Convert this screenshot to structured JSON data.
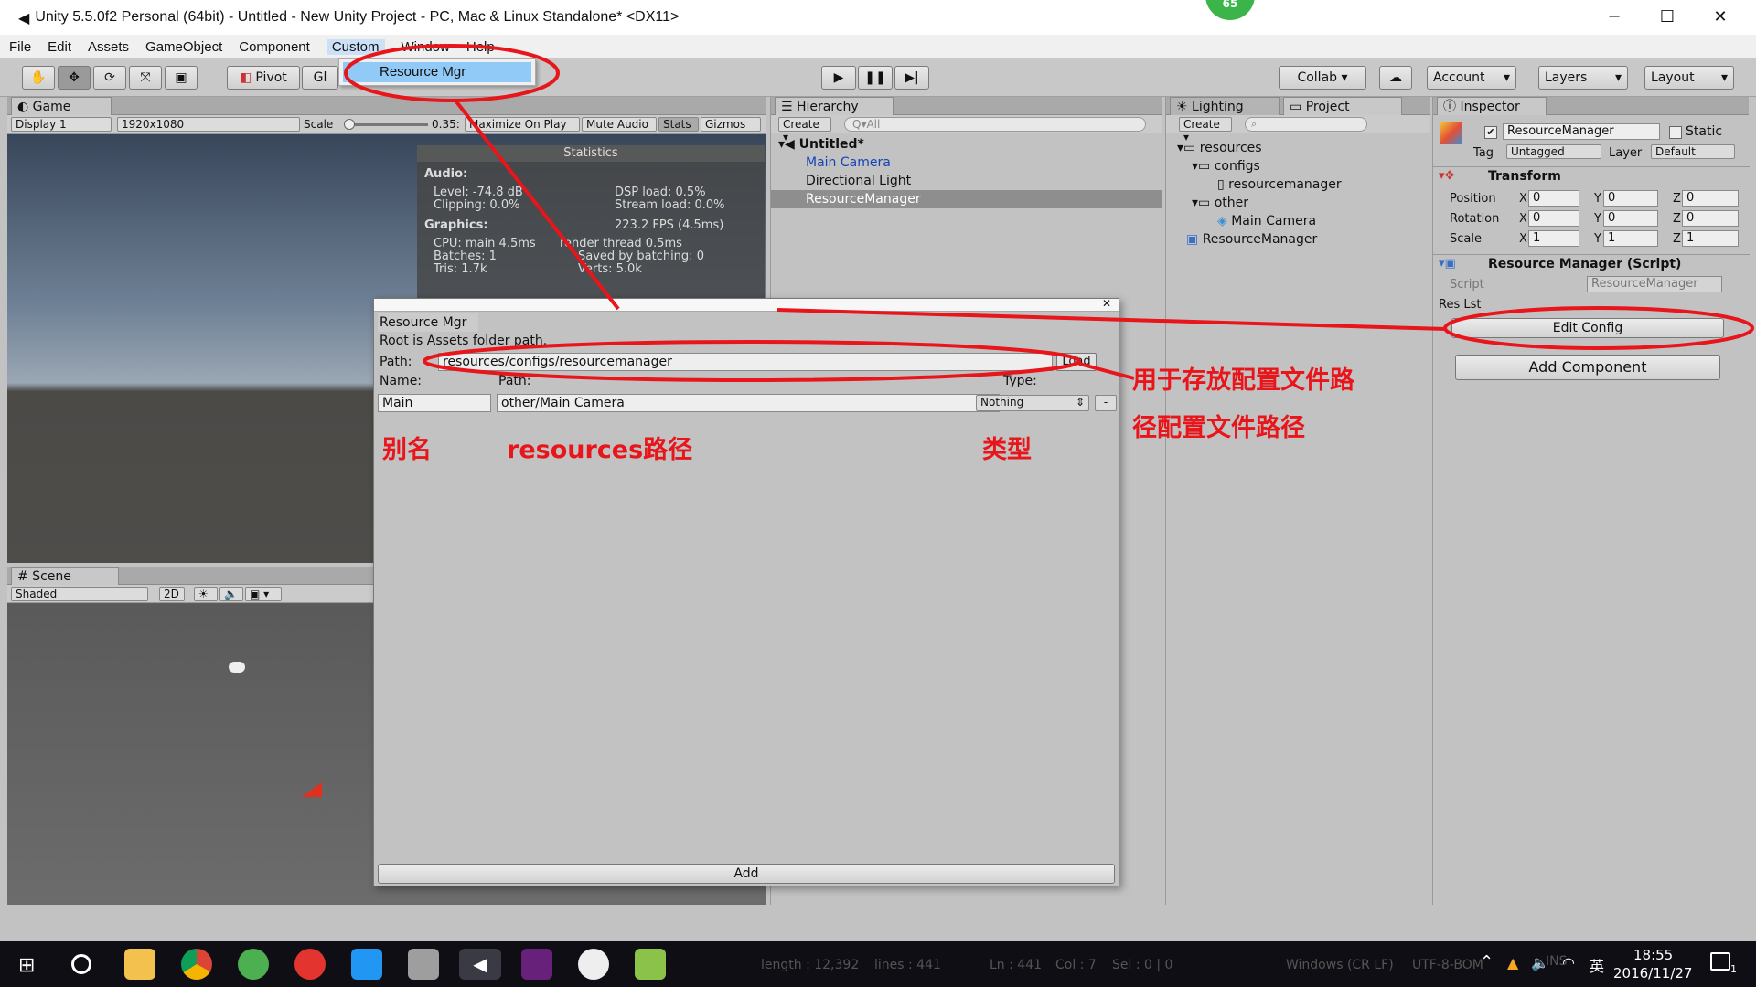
{
  "window": {
    "title": "Unity 5.5.0f2 Personal (64bit) - Untitled - New Unity Project - PC, Mac & Linux Standalone* <DX11>",
    "minimize": "─",
    "maximize": "☐",
    "close": "✕",
    "badge": "65"
  },
  "menu": [
    "File",
    "Edit",
    "Assets",
    "GameObject",
    "Component",
    "Custom",
    "Window",
    "Help"
  ],
  "menu_dropdown": {
    "item": "Resource Mgr"
  },
  "toolbar": {
    "pivot": "Pivot",
    "global": "Gl",
    "collab": "Collab ▾",
    "account": "Account",
    "layers": "Layers",
    "layout": "Layout"
  },
  "game": {
    "tab": "Game",
    "display": "Display 1",
    "resolution": "1920x1080",
    "scale_label": "Scale",
    "scale_value": "0.35:",
    "maximize": "Maximize On Play",
    "mute": "Mute Audio",
    "stats": "Stats",
    "gizmos": "Gizmos"
  },
  "statistics": {
    "title": "Statistics",
    "audio": "Audio:",
    "level": "Level: -74.8 dB",
    "clipping": "Clipping: 0.0%",
    "dsp": "DSP load: 0.5%",
    "stream": "Stream load: 0.0%",
    "graphics": "Graphics:",
    "fps": "223.2 FPS (4.5ms)",
    "cpu": "CPU: main 4.5ms",
    "render": "render thread 0.5ms",
    "batches": "Batches: 1",
    "saved": "Saved by batching: 0",
    "tris": "Tris: 1.7k",
    "verts": "Verts: 5.0k"
  },
  "scene": {
    "tab": "Scene",
    "shaded": "Shaded",
    "twod": "2D"
  },
  "hierarchy": {
    "tab": "Hierarchy",
    "create": "Create ▾",
    "search": "Q▾All",
    "scene": "Untitled*",
    "items": [
      "Main Camera",
      "Directional Light",
      "ResourceManager"
    ]
  },
  "project": {
    "lighting": "Lighting",
    "tab": "Project",
    "create": "Create ▾",
    "tree": [
      "resources",
      "configs",
      "resourcemanager",
      "other",
      "Main Camera",
      "ResourceManager"
    ]
  },
  "inspector": {
    "tab": "Inspector",
    "name": "ResourceManager",
    "static": "Static",
    "tag_label": "Tag",
    "tag": "Untagged",
    "layer_label": "Layer",
    "layer": "Default",
    "transform": "Transform",
    "position": "Position",
    "rotation": "Rotation",
    "scale": "Scale",
    "x": "X",
    "y": "Y",
    "z": "Z",
    "pos": [
      "0",
      "0",
      "0"
    ],
    "rot": [
      "0",
      "0",
      "0"
    ],
    "scl": [
      "1",
      "1",
      "1"
    ],
    "component": "Resource Manager (Script)",
    "script_label": "Script",
    "script": "ResourceManager",
    "res_lst": "Res Lst",
    "edit_config": "Edit Config",
    "add_component": "Add Component"
  },
  "dialog": {
    "title": "Resource Mgr",
    "hint": "Root is Assets folder path.",
    "path_label": "Path:",
    "path_value": "resources/configs/resourcemanager",
    "load": "Load",
    "name_header": "Name:",
    "path_header": "Path:",
    "type_header": "Type:",
    "row_name": "Main",
    "row_path": "other/Main Camera",
    "row_type": "Nothing",
    "row_remove": "-",
    "add": "Add"
  },
  "annotations": {
    "path_note1": "用于存放配置文件路",
    "path_note2": "径配置文件路径",
    "alias": "别名",
    "res_path": "resources路径",
    "type": "类型"
  },
  "statusbar": {
    "length": "length : 12,392",
    "lines": "lines : 441",
    "ln": "Ln : 441",
    "col": "Col : 7",
    "sel": "Sel : 0 | 0",
    "eol": "Windows (CR LF)",
    "enc": "UTF-8-BOM",
    "ins": "INS"
  },
  "taskbar": {
    "time": "18:55",
    "date": "2016/11/27",
    "lang": "英",
    "notif": "1"
  },
  "colors": {
    "annotation": "#e8151b",
    "selected": "#3e7de0",
    "unity_bg": "#c2c2c2"
  }
}
